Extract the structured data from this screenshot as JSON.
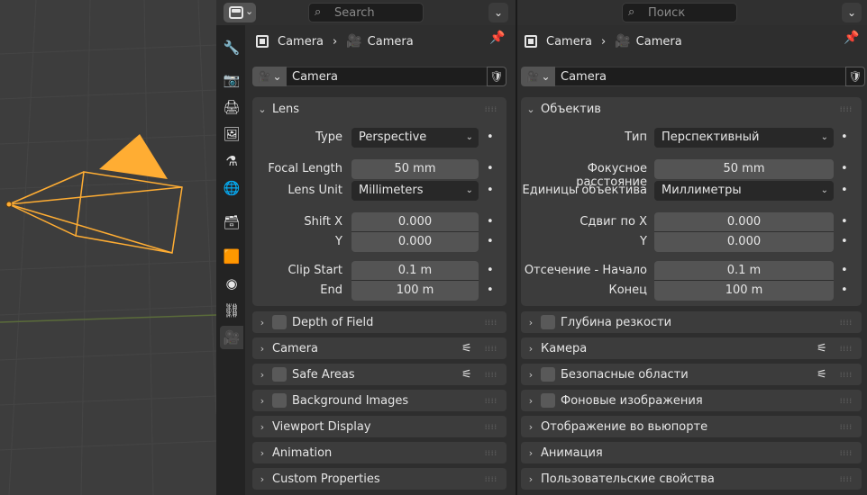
{
  "en": {
    "search_placeholder": "Search",
    "breadcrumb": {
      "object": "Camera",
      "data": "Camera"
    },
    "datablock_name": "Camera",
    "lens": {
      "title": "Lens",
      "type_label": "Type",
      "type_value": "Perspective",
      "focal_label": "Focal Length",
      "focal_value": "50 mm",
      "unit_label": "Lens Unit",
      "unit_value": "Millimeters",
      "shiftx_label": "Shift X",
      "shiftx_value": "0.000",
      "shifty_label": "Y",
      "shifty_value": "0.000",
      "clipstart_label": "Clip Start",
      "clipstart_value": "0.1 m",
      "clipend_label": "End",
      "clipend_value": "100 m"
    },
    "panels": [
      "Depth of Field",
      "Camera",
      "Safe Areas",
      "Background Images",
      "Viewport Display",
      "Animation",
      "Custom Properties"
    ]
  },
  "ru": {
    "search_placeholder": "Поиск",
    "breadcrumb": {
      "object": "Camera",
      "data": "Camera"
    },
    "datablock_name": "Camera",
    "lens": {
      "title": "Объектив",
      "type_label": "Тип",
      "type_value": "Перспективный",
      "focal_label": "Фокусное расстояние",
      "focal_value": "50 mm",
      "unit_label": "Единицы объектива",
      "unit_value": "Миллиметры",
      "shiftx_label": "Сдвиг по X",
      "shiftx_value": "0.000",
      "shifty_label": "Y",
      "shifty_value": "0.000",
      "clipstart_label": "Отсечение - Начало",
      "clipstart_value": "0.1 m",
      "clipend_label": "Конец",
      "clipend_value": "100 m"
    },
    "panels": [
      "Глубина резкости",
      "Камера",
      "Безопасные области",
      "Фоновые изображения",
      "Отображение во вьюпорте",
      "Анимация",
      "Пользовательские свойства"
    ]
  },
  "colors": {
    "camera_wire": "#ffad33",
    "active_tab_icon": "#3fbf8f",
    "viewport_bg": "#3d3d3d"
  }
}
